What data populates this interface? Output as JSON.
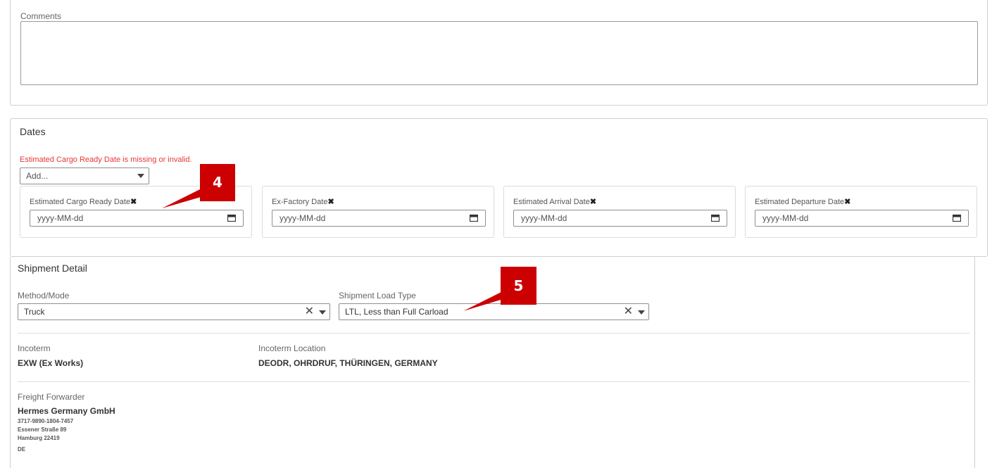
{
  "comments": {
    "label": "Comments",
    "value": ""
  },
  "dates": {
    "title": "Dates",
    "error": "Estimated Cargo Ready Date is missing or invalid.",
    "add_select": "Add...",
    "fields": [
      {
        "label": "Estimated Cargo Ready Date",
        "placeholder": "yyyy-MM-dd",
        "remove": "✖"
      },
      {
        "label": "Ex-Factory Date",
        "placeholder": "yyyy-MM-dd",
        "remove": "✖"
      },
      {
        "label": "Estimated Arrival Date",
        "placeholder": "yyyy-MM-dd",
        "remove": "✖"
      },
      {
        "label": "Estimated Departure Date",
        "placeholder": "yyyy-MM-dd",
        "remove": "✖"
      }
    ]
  },
  "shipment": {
    "title": "Shipment Detail",
    "method_label": "Method/Mode",
    "method_value": "Truck",
    "load_label": "Shipment Load Type",
    "load_value": "LTL, Less than Full Carload",
    "clear": "✕",
    "incoterm_label": "Incoterm",
    "incoterm_value": "EXW (Ex Works)",
    "incoterm_location_label": "Incoterm Location",
    "incoterm_location_value": "DEODR, OHRDRUF, THÜRINGEN, GERMANY",
    "forwarder_label": "Freight Forwarder",
    "forwarder_name": "Hermes Germany GmbH",
    "forwarder_lines": [
      "3717-9890-1804-7457",
      "Essener Straße 89",
      "Hamburg 22419",
      "DE"
    ]
  },
  "callouts": {
    "badge4": "4",
    "badge5": "5"
  },
  "colors": {
    "callout": "#cc0000",
    "error": "#e53935",
    "border": "#cfcfcf"
  }
}
